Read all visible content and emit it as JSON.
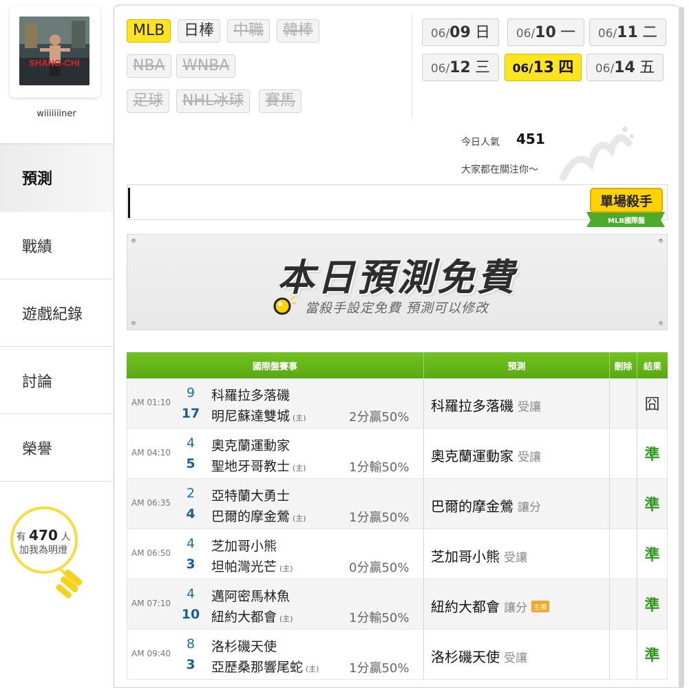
{
  "user": {
    "name": "wiiiiiiiner",
    "avatar_caption": "SHANG-CHI"
  },
  "nav": [
    {
      "label": "預測",
      "active": true
    },
    {
      "label": "戰績",
      "active": false
    },
    {
      "label": "遊戲紀錄",
      "active": false
    },
    {
      "label": "討論",
      "active": false
    },
    {
      "label": "榮譽",
      "active": false
    }
  ],
  "fans": {
    "prefix": "有",
    "count": "470",
    "suffix": "人",
    "line2": "加我為明燈"
  },
  "sport_tabs": [
    {
      "label": "MLB",
      "state": "active"
    },
    {
      "label": "日棒",
      "state": "normal"
    },
    {
      "label": "中職",
      "state": "disabled"
    },
    {
      "label": "韓棒",
      "state": "disabled"
    },
    {
      "label": "NBA",
      "state": "disabled"
    },
    {
      "label": "WNBA",
      "state": "disabled"
    },
    {
      "label": "足球",
      "state": "disabled"
    },
    {
      "label": "NHL冰球",
      "state": "disabled"
    },
    {
      "label": "賽馬",
      "state": "disabled"
    }
  ],
  "dates": [
    {
      "md": "06/",
      "dd": "09",
      "wd": "日",
      "active": false
    },
    {
      "md": "06/",
      "dd": "10",
      "wd": "一",
      "active": false
    },
    {
      "md": "06/",
      "dd": "11",
      "wd": "二",
      "active": false
    },
    {
      "md": "06/",
      "dd": "12",
      "wd": "三",
      "active": false
    },
    {
      "md": "06/",
      "dd": "13",
      "wd": "四",
      "active": true
    },
    {
      "md": "06/",
      "dd": "14",
      "wd": "五",
      "active": false
    }
  ],
  "popularity": {
    "label": "今日人氣",
    "value": "451",
    "sub": "大家都在關注你～"
  },
  "badge": {
    "title": "單場殺手",
    "sub": "MLB國際盤"
  },
  "banner": {
    "title": "本日預測免費",
    "sub": "當殺手設定免費  預測可以修改"
  },
  "table": {
    "headers": {
      "game": "國際盤賽事",
      "pred": "預測",
      "del": "刪除",
      "res": "結果"
    },
    "home_mark": "(主)",
    "rows": [
      {
        "time": "AM 01:10",
        "s1": "9",
        "s2": "17",
        "t1": "科羅拉多落磯",
        "t2": "明尼蘇達雙城",
        "odds": "2分贏50%",
        "pred": "科羅拉多落磯",
        "ptype": "受讓",
        "tag": "",
        "result": "囧",
        "ok": false
      },
      {
        "time": "AM 04:10",
        "s1": "4",
        "s2": "5",
        "t1": "奧克蘭運動家",
        "t2": "聖地牙哥教士",
        "odds": "1分輸50%",
        "pred": "奧克蘭運動家",
        "ptype": "受讓",
        "tag": "",
        "result": "準",
        "ok": true
      },
      {
        "time": "AM 06:35",
        "s1": "2",
        "s2": "4",
        "t1": "亞特蘭大勇士",
        "t2": "巴爾的摩金鶯",
        "odds": "1分贏50%",
        "pred": "巴爾的摩金鶯",
        "ptype": "讓分",
        "tag": "",
        "result": "準",
        "ok": true
      },
      {
        "time": "AM 06:50",
        "s1": "4",
        "s2": "3",
        "t1": "芝加哥小熊",
        "t2": "坦帕灣光芒",
        "odds": "0分贏50%",
        "pred": "芝加哥小熊",
        "ptype": "受讓",
        "tag": "",
        "result": "準",
        "ok": true
      },
      {
        "time": "AM 07:10",
        "s1": "4",
        "s2": "10",
        "t1": "邁阿密馬林魚",
        "t2": "紐約大都會",
        "odds": "1分輸50%",
        "pred": "紐約大都會",
        "ptype": "讓分",
        "tag": "主推",
        "result": "準",
        "ok": true
      },
      {
        "time": "AM 09:40",
        "s1": "8",
        "s2": "3",
        "t1": "洛杉磯天使",
        "t2": "亞歷桑那響尾蛇",
        "odds": "1分贏50%",
        "pred": "洛杉磯天使",
        "ptype": "受讓",
        "tag": "",
        "result": "準",
        "ok": true
      }
    ]
  }
}
